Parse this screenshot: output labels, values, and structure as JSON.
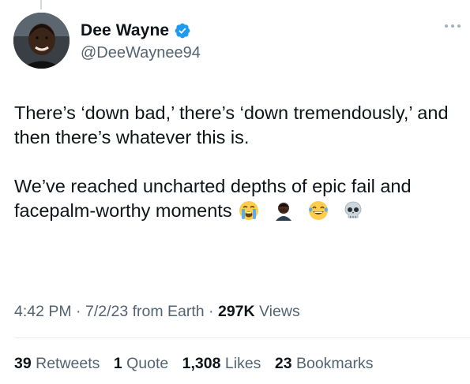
{
  "author": {
    "display_name": "Dee Wayne",
    "handle": "@DeeWaynee94",
    "verified": true,
    "verified_color": "#1d9bf0"
  },
  "tweet": {
    "paragraph1": "There’s ‘down bad,’ there’s ‘down tremendously,’ and then there’s whatever this is.",
    "paragraph2": "We’ve reached uncharted depths of epic fail and facepalm-worthy moments",
    "emojis": [
      "loudly-crying-face",
      "person-facepalming",
      "face-with-tears-of-joy",
      "skull"
    ]
  },
  "meta": {
    "time": "4:42 PM",
    "sep1": " · ",
    "date": "7/2/23",
    "source": " from Earth",
    "sep2": " · ",
    "views_count": "297K",
    "views_label": " Views"
  },
  "stats": {
    "retweets_count": "39",
    "retweets_label": " Retweets",
    "quotes_count": "1",
    "quotes_label": " Quote",
    "likes_count": "1,308",
    "likes_label": " Likes",
    "bookmarks_count": "23",
    "bookmarks_label": " Bookmarks"
  },
  "icons": {
    "more": "more-dots-icon",
    "verified": "verified-badge-icon"
  }
}
